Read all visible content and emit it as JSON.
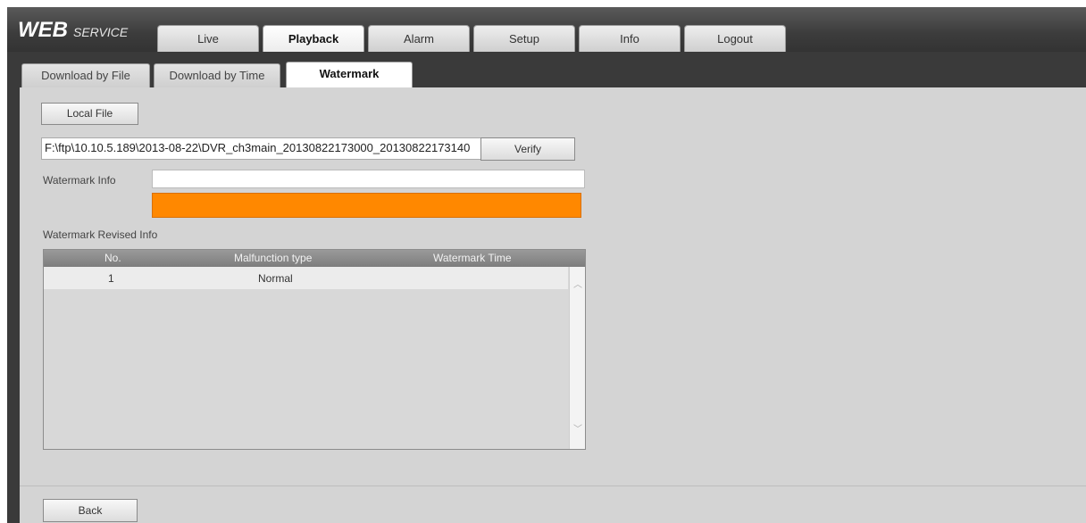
{
  "logo": {
    "brand": "WEB",
    "service": "SERVICE"
  },
  "main_tabs": [
    {
      "label": "Live"
    },
    {
      "label": "Playback"
    },
    {
      "label": "Alarm"
    },
    {
      "label": "Setup"
    },
    {
      "label": "Info"
    },
    {
      "label": "Logout"
    }
  ],
  "active_main_tab": "Playback",
  "sub_tabs": [
    {
      "label": "Download by File"
    },
    {
      "label": "Download by Time"
    },
    {
      "label": "Watermark"
    }
  ],
  "active_sub_tab": "Watermark",
  "local_file_button": "Local File",
  "file_path": "F:\\ftp\\10.10.5.189\\2013-08-22\\DVR_ch3main_20130822173000_20130822173140",
  "verify_button": "Verify",
  "watermark_info_label": "Watermark Info",
  "watermark_info_value": "",
  "watermark_status_color": "#ff8800",
  "revised_info_label": "Watermark Revised Info",
  "table": {
    "columns": [
      "No.",
      "Malfunction type",
      "Watermark Time"
    ],
    "rows": [
      {
        "no": "1",
        "type": "Normal",
        "time": ""
      }
    ]
  },
  "back_button": "Back"
}
